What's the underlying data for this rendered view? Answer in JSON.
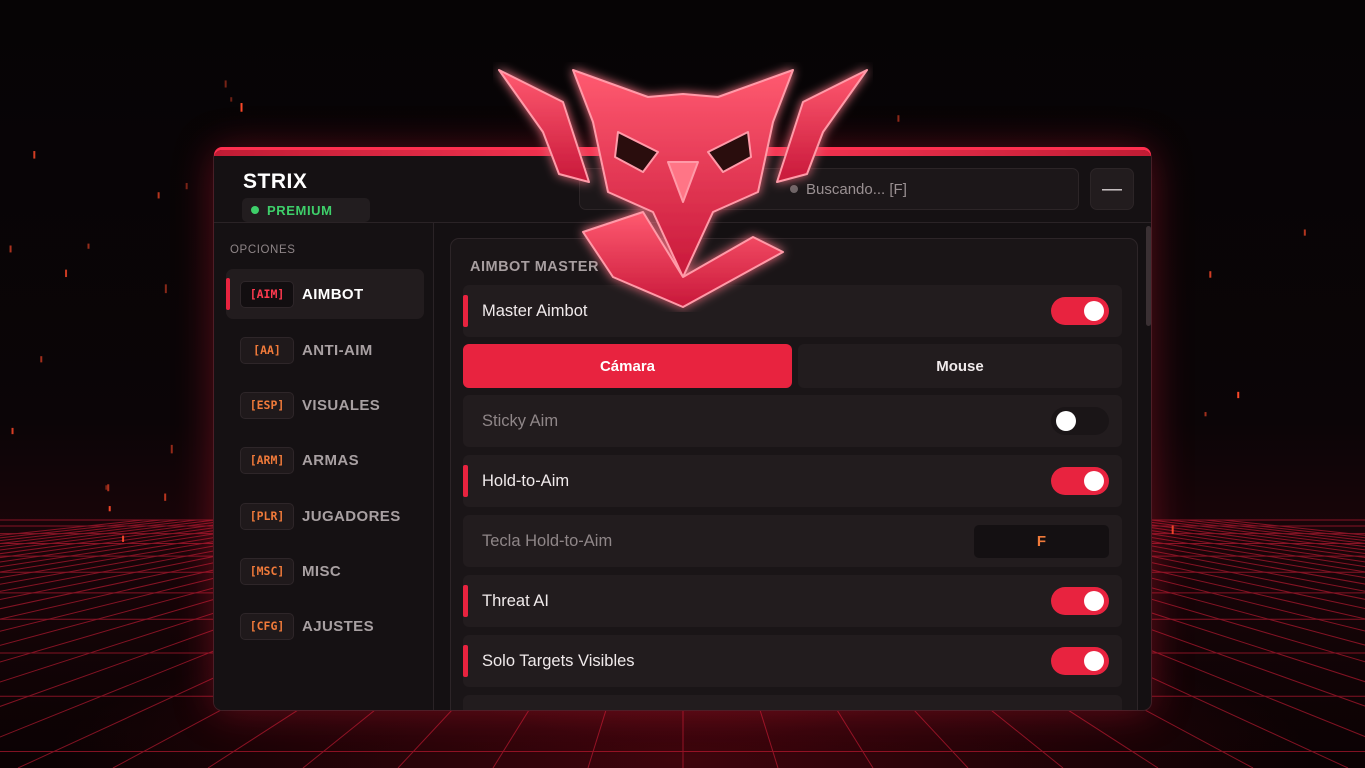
{
  "app": {
    "brand": "STRIX",
    "badge": "PREMIUM",
    "search_text": "Buscando... [F]",
    "minimize_glyph": "—"
  },
  "sidebar": {
    "title": "OPCIONES",
    "items": [
      {
        "tag": "[AIM]",
        "label": "AIMBOT",
        "active": true
      },
      {
        "tag": "[AA]",
        "label": "ANTI-AIM"
      },
      {
        "tag": "[ESP]",
        "label": "VISUALES"
      },
      {
        "tag": "[ARM]",
        "label": "ARMAS"
      },
      {
        "tag": "[PLR]",
        "label": "JUGADORES"
      },
      {
        "tag": "[MSC]",
        "label": "MISC"
      },
      {
        "tag": "[CFG]",
        "label": "AJUSTES"
      }
    ]
  },
  "main": {
    "section_title": "AIMBOT MASTER",
    "master": {
      "label": "Master Aimbot",
      "on": true
    },
    "mode_options": [
      "Cámara",
      "Mouse"
    ],
    "mode_selected": "Cámara",
    "sticky": {
      "label": "Sticky Aim",
      "on": false
    },
    "hold": {
      "label": "Hold-to-Aim",
      "on": true
    },
    "hold_key": {
      "label": "Tecla Hold-to-Aim",
      "value": "F"
    },
    "threat": {
      "label": "Threat AI",
      "on": true
    },
    "visible": {
      "label": "Solo Targets Visibles",
      "on": true
    }
  },
  "colors": {
    "accent": "#e8233f",
    "premium": "#3ecf6a",
    "tag": "#f07a3a",
    "panel": "#141012"
  },
  "icons": [
    "owl-logo-icon",
    "status-dot-icon",
    "minimize-icon"
  ]
}
